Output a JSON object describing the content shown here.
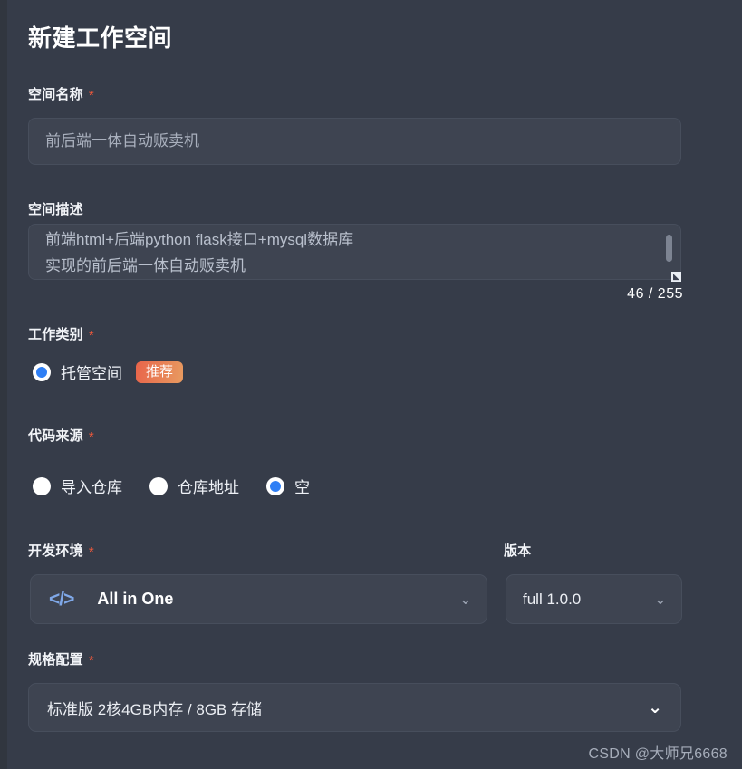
{
  "page": {
    "title": "新建工作空间"
  },
  "fields": {
    "name": {
      "label": "空间名称",
      "required_mark": "*",
      "placeholder": "前后端一体自动贩卖机",
      "value": ""
    },
    "description": {
      "label": "空间描述",
      "value": "前端html+后端python flask接口+mysql数据库\n实现的前后端一体自动贩卖机",
      "char_count": "46 / 255"
    },
    "work_type": {
      "label": "工作类别",
      "required_mark": "*",
      "options": [
        {
          "label": "托管空间",
          "selected": true,
          "badge": "推荐"
        }
      ]
    },
    "code_source": {
      "label": "代码来源",
      "required_mark": "*",
      "options": [
        {
          "label": "导入仓库",
          "selected": false
        },
        {
          "label": "仓库地址",
          "selected": false
        },
        {
          "label": "空",
          "selected": true
        }
      ]
    },
    "dev_env": {
      "label": "开发环境",
      "required_mark": "*",
      "icon": "code-brackets-icon",
      "value": "All in One",
      "chevron": "chevron-down-icon"
    },
    "version": {
      "label": "版本",
      "value": "full 1.0.0",
      "chevron": "chevron-down-icon"
    },
    "spec": {
      "label": "规格配置",
      "required_mark": "*",
      "value": "标准版 2核4GB内存 / 8GB 存储",
      "chevron": "chevron-down-icon"
    }
  },
  "icons": {
    "code": "</>",
    "chevron_down": "⌄",
    "resize_grip": "◣"
  },
  "watermark": "CSDN @大师兄6668",
  "colors": {
    "background": "#363c49",
    "field_fill": "#3e4451",
    "accent_blue": "#2f7ff5",
    "required_red": "#f2593b",
    "badge_from": "#e8644a",
    "badge_to": "#e89b60",
    "code_icon_blue": "#7fa8e8"
  }
}
